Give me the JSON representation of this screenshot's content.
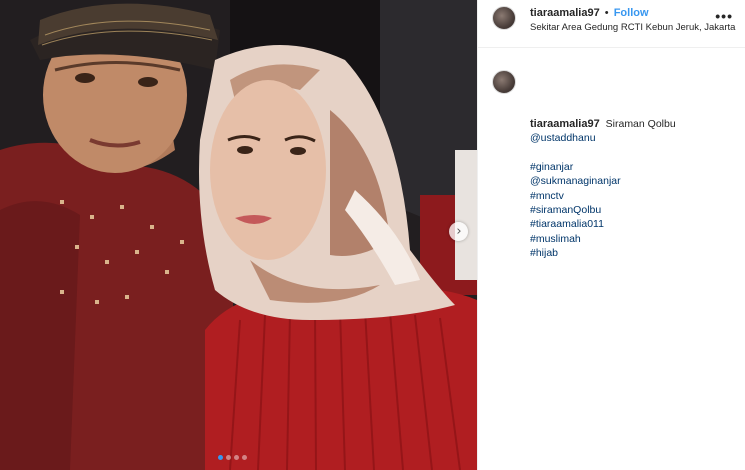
{
  "post": {
    "username": "tiaraamalia97",
    "separator": "•",
    "follow_label": "Follow",
    "location": "Sekitar Area Gedung RCTI Kebun Jeruk, Jakarta",
    "more_icon": "more-horizontal-icon",
    "more_glyph": "•••"
  },
  "caption": {
    "username": "tiaraamalia97",
    "text": "Siraman Qolbu",
    "mention": "@ustaddhanu",
    "tags_group": [
      "#ginanjar",
      "@sukmanaginanjar",
      "#mnctv",
      "#siramanQolbu",
      "#tiaraamalia011",
      "#muslimah",
      "#hijab"
    ]
  },
  "carousel": {
    "next_icon": "chevron-right-icon",
    "next_glyph": "›",
    "dot_count": 4,
    "active_index": 0
  },
  "colors": {
    "link": "#003569",
    "follow": "#3897f0",
    "dot_active": "#3897f0"
  }
}
